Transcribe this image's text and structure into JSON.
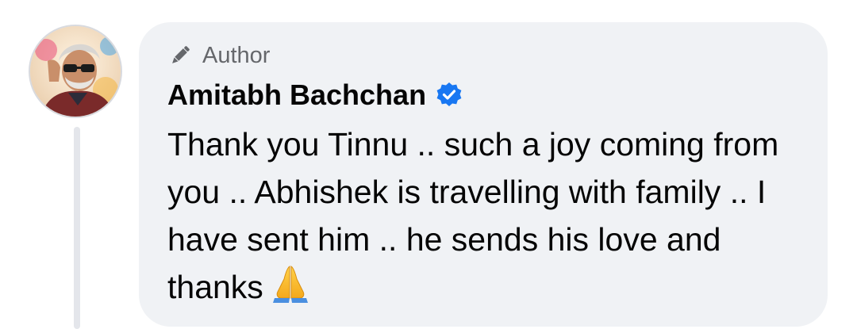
{
  "comment": {
    "badge_label": "Author",
    "author_name": "Amitabh Bachchan",
    "message_text": "Thank you Tinnu .. such a joy coming from you .. Abhishek is travelling with family .. I have sent him .. he sends his love and thanks",
    "trailing_emoji": "folded-hands-emoji",
    "verified": true
  },
  "icons": {
    "badge": "pencil-icon",
    "verified": "verified-badge-icon"
  },
  "colors": {
    "bubble_bg": "#f0f2f5",
    "badge_text": "#65676b",
    "name_text": "#050505",
    "verified_blue": "#1877f2",
    "thread_line": "#e4e6eb"
  }
}
